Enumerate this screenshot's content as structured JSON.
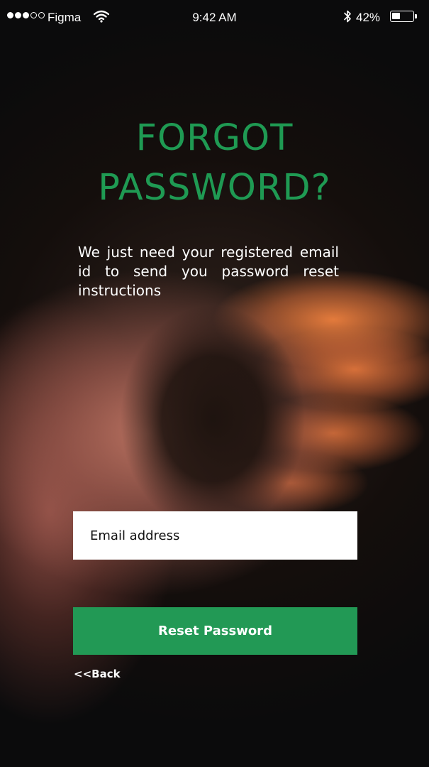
{
  "status_bar": {
    "signal_dots_filled": 3,
    "signal_dots_total": 5,
    "carrier": "Figma",
    "wifi_icon": "wifi-icon",
    "time": "9:42 AM",
    "bluetooth_icon": "bluetooth-icon",
    "battery_percent_text": "42%",
    "battery_level": 0.42
  },
  "title": {
    "line1": "FORGOT",
    "line2": "PASSWORD?",
    "color": "#1f9a53"
  },
  "subtitle": "We just need your registered email id to send you password reset instructions",
  "form": {
    "email_placeholder": "Email address",
    "email_value": "",
    "reset_button_label": "Reset Password",
    "reset_button_color": "#229955"
  },
  "back_link": "<<Back"
}
